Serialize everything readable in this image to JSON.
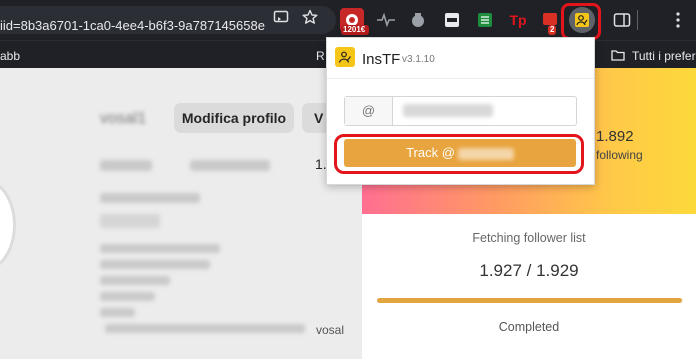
{
  "browser": {
    "url_text": "iid=8b3a6701-1ca0-4ee4-b6f3-9a787145658e",
    "url_icons": [
      "cast-icon",
      "star-icon"
    ],
    "extensions": [
      {
        "name": "extension-badge-1201",
        "badge": "1201€",
        "color": "#d62d2d"
      },
      {
        "name": "pulse-icon",
        "color": "#9aa0a6"
      },
      {
        "name": "puzzle-gear-icon",
        "color": "#9aa0a6"
      },
      {
        "name": "extension-dark-icon",
        "color": "#e8eaed"
      },
      {
        "name": "extension-green-icon",
        "color": "#1e8e3e"
      },
      {
        "name": "extension-tp-icon",
        "label": "Tp",
        "color": "#e2141c"
      },
      {
        "name": "extension-badge-2",
        "badge": "2",
        "color": "#d93025"
      },
      {
        "name": "instf-extension-icon",
        "color": "#f5c518"
      },
      {
        "name": "sidepanel-icon",
        "color": "#dfe1e5"
      }
    ],
    "menu_icon": "more-vertical-icon"
  },
  "bookmarks": {
    "left_text": "abb",
    "left_fragment": "R",
    "right_item": "Tutti i preferiti"
  },
  "profile": {
    "username": "vosal1",
    "edit_button": "Modifica profilo",
    "second_button": "V",
    "stats_fragment": "1.",
    "link_fragment": "vosal"
  },
  "panel": {
    "following_count": "1.892",
    "following_label": "following",
    "fetch_label": "Fetching follower list",
    "fetch_count": "1.927 / 1.929",
    "progress": 0.998,
    "completed_label": "Completed"
  },
  "popup": {
    "title": "InsTF",
    "version": "v3.1.10",
    "at_prefix": "@",
    "track_label": "Track @"
  },
  "colors": {
    "accent": "#e8a43e",
    "highlight": "#e2141c",
    "gradient_start": "#ff6f91",
    "gradient_end": "#fcd93a"
  }
}
